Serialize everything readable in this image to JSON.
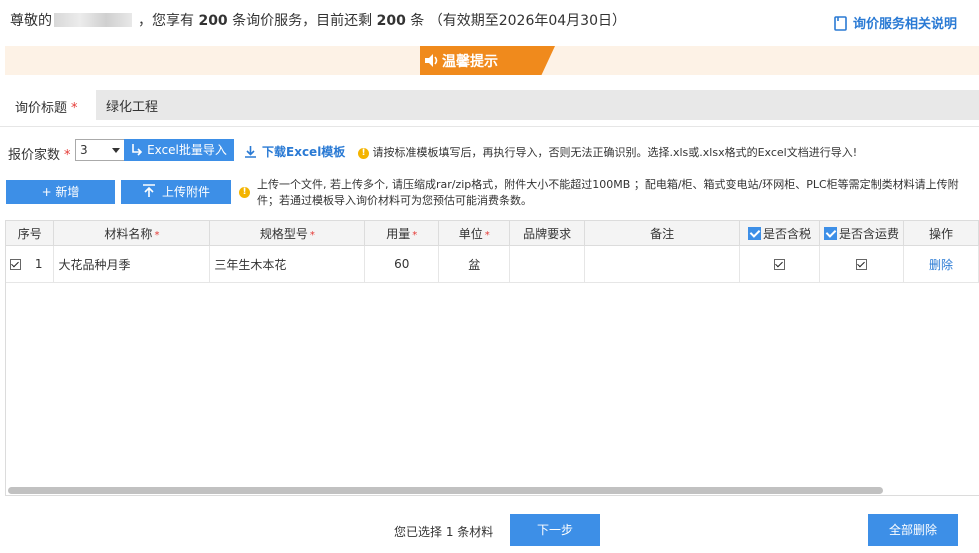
{
  "header": {
    "greeting_prefix": "尊敬的",
    "greeting_mid": "，您享有",
    "service_total": "200",
    "service_mid": "条询价服务，目前还剩",
    "service_left": "200",
    "service_suffix": "条 （有效期至2026年04月30日）",
    "help_link": "询价服务相关说明"
  },
  "tip": {
    "label": "温馨提示"
  },
  "form": {
    "title_label": "询价标题",
    "title_value": "绿化工程",
    "quote_count_label": "报价家数",
    "quote_count_value": "3",
    "excel_import_label": "Excel批量导入",
    "download_template_label": "下载Excel模板",
    "import_note": "请按标准模板填写后，再执行导入，否则无法正确识别。选择.xls或.xlsx格式的Excel文档进行导入!",
    "add_label": "+ 新增",
    "upload_label": "上传附件",
    "upload_note": "上传一个文件, 若上传多个, 请压缩成rar/zip格式，附件大小不能超过100MB ；配电箱/柜、箱式变电站/环网柜、PLC柜等需定制类材料请上传附件；若通过模板导入询价材料可为您预估可能消费条数。"
  },
  "table": {
    "headers": {
      "index": "序号",
      "name": "材料名称",
      "spec": "规格型号",
      "qty": "用量",
      "unit": "单位",
      "brand": "品牌要求",
      "remark": "备注",
      "tax": "是否含税",
      "freight": "是否含运费",
      "action": "操作"
    },
    "rows": [
      {
        "index": "1",
        "name": "大花品种月季",
        "spec": "三年生木本花",
        "qty": "60",
        "unit": "盆",
        "brand": "",
        "remark": "",
        "tax": true,
        "freight": true,
        "action": "删除"
      }
    ]
  },
  "footer": {
    "selected_text": "您已选择 1 条材料",
    "next_label": "下一步",
    "delete_all_label": "全部删除"
  },
  "colors": {
    "accent": "#3d8fe7",
    "tip_orange": "#f08a1c",
    "link": "#2a7ad4",
    "required": "#e53935"
  }
}
